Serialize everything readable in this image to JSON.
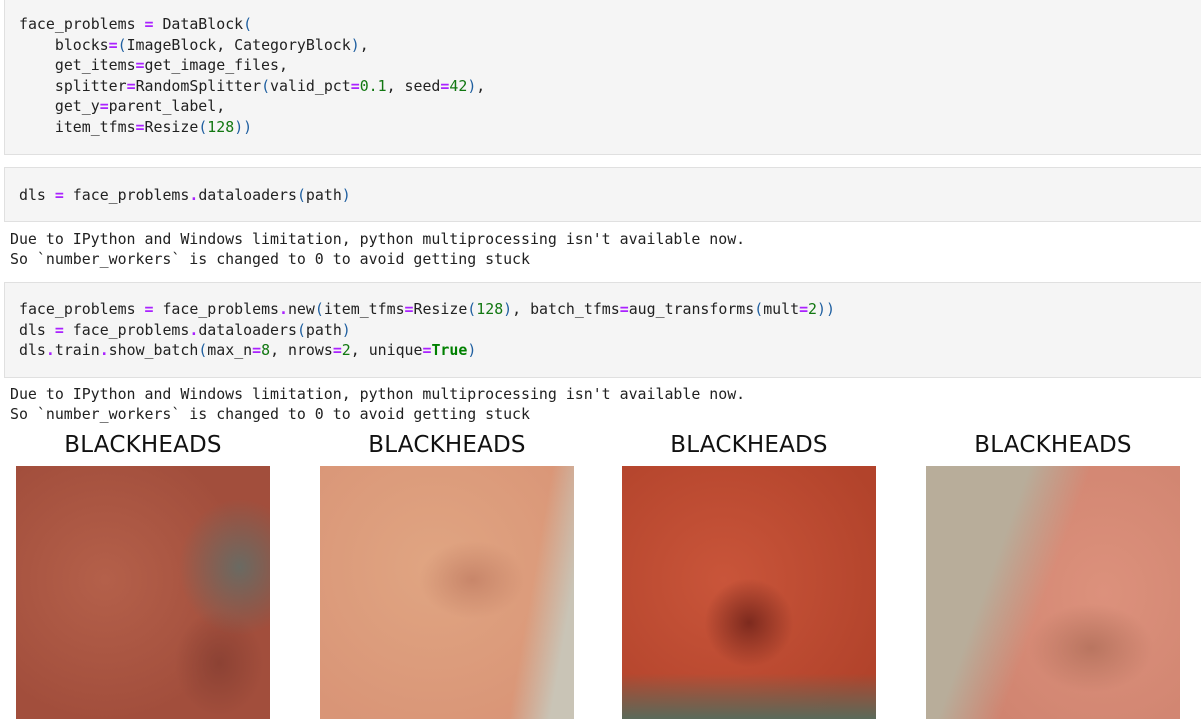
{
  "cells": [
    {
      "type": "code",
      "lines": [
        [
          [
            "t",
            "face_problems "
          ],
          [
            "op",
            "="
          ],
          [
            "t",
            " DataBlock"
          ],
          [
            "p",
            "("
          ]
        ],
        [
          [
            "t",
            "    blocks"
          ],
          [
            "op",
            "="
          ],
          [
            "p",
            "("
          ],
          [
            "t",
            "ImageBlock, CategoryBlock"
          ],
          [
            "p",
            ")"
          ],
          [
            "t",
            ","
          ]
        ],
        [
          [
            "t",
            "    get_items"
          ],
          [
            "op",
            "="
          ],
          [
            "t",
            "get_image_files,"
          ]
        ],
        [
          [
            "t",
            "    splitter"
          ],
          [
            "op",
            "="
          ],
          [
            "t",
            "RandomSplitter"
          ],
          [
            "p",
            "("
          ],
          [
            "t",
            "valid_pct"
          ],
          [
            "op",
            "="
          ],
          [
            "num",
            "0.1"
          ],
          [
            "t",
            ", seed"
          ],
          [
            "op",
            "="
          ],
          [
            "num",
            "42"
          ],
          [
            "p",
            ")"
          ],
          [
            "t",
            ","
          ]
        ],
        [
          [
            "t",
            "    get_y"
          ],
          [
            "op",
            "="
          ],
          [
            "t",
            "parent_label,"
          ]
        ],
        [
          [
            "t",
            "    item_tfms"
          ],
          [
            "op",
            "="
          ],
          [
            "t",
            "Resize"
          ],
          [
            "p",
            "("
          ],
          [
            "num",
            "128"
          ],
          [
            "p",
            "))"
          ]
        ]
      ]
    },
    {
      "type": "code",
      "lines": [
        [
          [
            "t",
            "dls "
          ],
          [
            "op",
            "="
          ],
          [
            "t",
            " face_problems"
          ],
          [
            "op",
            "."
          ],
          [
            "t",
            "dataloaders"
          ],
          [
            "p",
            "("
          ],
          [
            "t",
            "path"
          ],
          [
            "p",
            ")"
          ]
        ]
      ]
    },
    {
      "type": "output",
      "lines": [
        "Due to IPython and Windows limitation, python multiprocessing isn't available now.",
        "So `number_workers` is changed to 0 to avoid getting stuck"
      ]
    },
    {
      "type": "code",
      "lines": [
        [
          [
            "t",
            "face_problems "
          ],
          [
            "op",
            "="
          ],
          [
            "t",
            " face_problems"
          ],
          [
            "op",
            "."
          ],
          [
            "t",
            "new"
          ],
          [
            "p",
            "("
          ],
          [
            "t",
            "item_tfms"
          ],
          [
            "op",
            "="
          ],
          [
            "t",
            "Resize"
          ],
          [
            "p",
            "("
          ],
          [
            "num",
            "128"
          ],
          [
            "p",
            ")"
          ],
          [
            "t",
            ", batch_tfms"
          ],
          [
            "op",
            "="
          ],
          [
            "t",
            "aug_transforms"
          ],
          [
            "p",
            "("
          ],
          [
            "t",
            "mult"
          ],
          [
            "op",
            "="
          ],
          [
            "num",
            "2"
          ],
          [
            "p",
            "))"
          ]
        ],
        [
          [
            "t",
            "dls "
          ],
          [
            "op",
            "="
          ],
          [
            "t",
            " face_problems"
          ],
          [
            "op",
            "."
          ],
          [
            "t",
            "dataloaders"
          ],
          [
            "p",
            "("
          ],
          [
            "t",
            "path"
          ],
          [
            "p",
            ")"
          ]
        ],
        [
          [
            "t",
            "dls"
          ],
          [
            "op",
            "."
          ],
          [
            "t",
            "train"
          ],
          [
            "op",
            "."
          ],
          [
            "t",
            "show_batch"
          ],
          [
            "p",
            "("
          ],
          [
            "t",
            "max_n"
          ],
          [
            "op",
            "="
          ],
          [
            "num",
            "8"
          ],
          [
            "t",
            ", nrows"
          ],
          [
            "op",
            "="
          ],
          [
            "num",
            "2"
          ],
          [
            "t",
            ", unique"
          ],
          [
            "op",
            "="
          ],
          [
            "kw",
            "True"
          ],
          [
            "p",
            ")"
          ]
        ]
      ]
    },
    {
      "type": "output",
      "lines": [
        "Due to IPython and Windows limitation, python multiprocessing isn't available now.",
        "So `number_workers` is changed to 0 to avoid getting stuck"
      ]
    }
  ],
  "batch": {
    "tiles": [
      {
        "label": "BLACKHEADS",
        "description": "side view of cheek and nose, reddish skin",
        "palette": [
          "#b4604a",
          "#a24e3c",
          "#8c4234",
          "#6a6a62"
        ]
      },
      {
        "label": "BLACKHEADS",
        "description": "profile of nose, light peach skin",
        "palette": [
          "#e0a582",
          "#d99577",
          "#c8866a",
          "#c9c4b6"
        ]
      },
      {
        "label": "BLACKHEADS",
        "description": "close-up of nose, saturated red tone",
        "palette": [
          "#c9553a",
          "#b2432b",
          "#7d2a1e",
          "#5a6a5a"
        ]
      },
      {
        "label": "BLACKHEADS",
        "description": "profile of nose against grey background",
        "palette": [
          "#dc917c",
          "#d08470",
          "#b97560",
          "#b8ad9a"
        ]
      }
    ]
  }
}
